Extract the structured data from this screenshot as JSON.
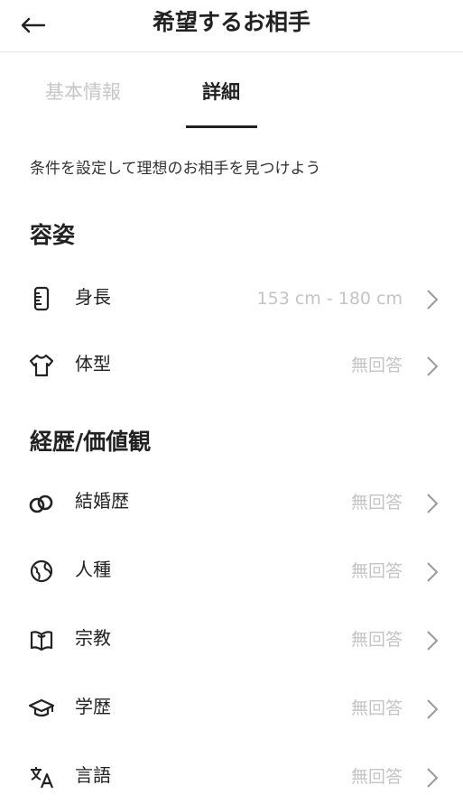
{
  "header": {
    "title": "希望するお相手"
  },
  "tabs": [
    {
      "label": "基本情報",
      "active": false
    },
    {
      "label": "詳細",
      "active": true
    }
  ],
  "subtitle": "条件を設定して理想のお相手を見つけよう",
  "sections": [
    {
      "title": "容姿",
      "items": [
        {
          "label": "身長",
          "value": "153 cm - 180 cm",
          "icon": "ruler-icon"
        },
        {
          "label": "体型",
          "value": "無回答",
          "icon": "tshirt-icon"
        }
      ]
    },
    {
      "title": "経歴/価値観",
      "items": [
        {
          "label": "結婚歴",
          "value": "無回答",
          "icon": "rings-icon"
        },
        {
          "label": "人種",
          "value": "無回答",
          "icon": "globe-icon"
        },
        {
          "label": "宗教",
          "value": "無回答",
          "icon": "book-icon"
        },
        {
          "label": "学歴",
          "value": "無回答",
          "icon": "graduation-cap-icon"
        },
        {
          "label": "言語",
          "value": "無回答",
          "icon": "translate-icon"
        }
      ]
    }
  ],
  "colors": {
    "text": "#222222",
    "muted": "#c4c4c4",
    "divider": "#e6e6e6"
  }
}
